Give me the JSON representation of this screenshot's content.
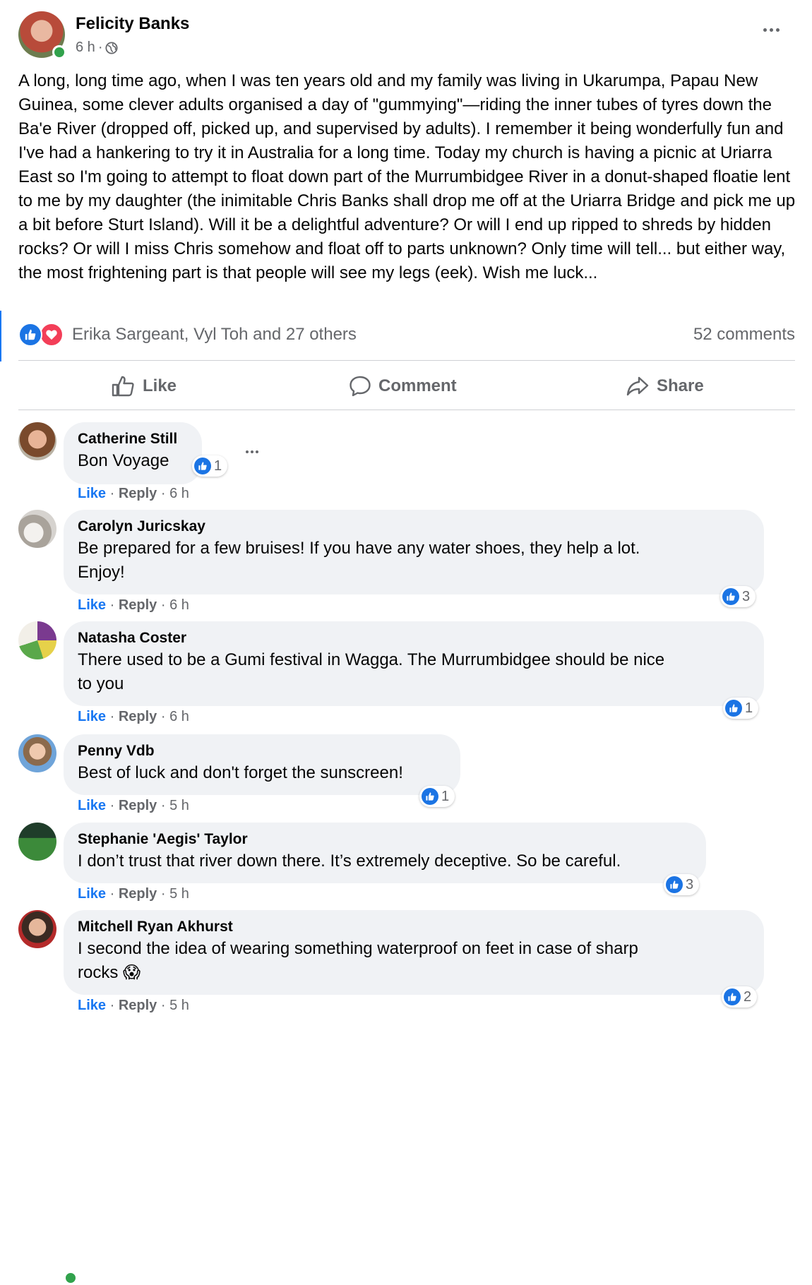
{
  "post": {
    "author": "Felicity Banks",
    "time": "6 h",
    "sep": "·",
    "text": "A long, long time ago, when I was ten years old and my family was living in Ukarumpa, Papau New Guinea, some clever adults organised a day of \"gummying\"—riding the inner tubes of tyres down the Ba'e River (dropped off, picked up, and supervised by adults). I remember it being wonderfully fun and I've had a hankering to try it in Australia for a long time. Today my church is having a picnic at Uriarra East so I'm going to attempt to float down part of the Murrumbidgee River in a donut-shaped floatie lent to me by my daughter (the inimitable Chris Banks shall drop me off at the Uriarra Bridge and pick me up a bit before Sturt Island). Will it be a delightful adventure? Or will I end up ripped to shreds by hidden rocks? Or will I miss Chris somehow and float off to parts unknown? Only time will tell... but either way, the most frightening part is that people will see my legs (eek). Wish me luck...",
    "reactions": "Erika Sargeant, Vyl Toh and 27 others",
    "comments_count": "52 comments"
  },
  "actions": {
    "like": "Like",
    "comment": "Comment",
    "share": "Share"
  },
  "comment_labels": {
    "like": "Like",
    "reply": "Reply",
    "dot": "·"
  },
  "comments": [
    {
      "name": "Catherine Still",
      "line1": "Bon Voyage",
      "line2": "",
      "reactions": "1",
      "time": "6 h"
    },
    {
      "name": "Carolyn Juricskay",
      "line1": "Be prepared for a few bruises! If you have any water shoes, they help a lot.",
      "line2": "Enjoy!",
      "reactions": "3",
      "time": "6 h"
    },
    {
      "name": "Natasha Coster",
      "line1": "There used to be a Gumi festival in Wagga. The Murrumbidgee should be nice",
      "line2": "to you",
      "reactions": "1",
      "time": "6 h"
    },
    {
      "name": "Penny Vdb",
      "line1": "Best of luck and don't forget the sunscreen!",
      "line2": "",
      "reactions": "1",
      "time": "5 h"
    },
    {
      "name": "Stephanie 'Aegis' Taylor",
      "line1": "I don’t trust that river down there. It’s extremely deceptive. So be careful.",
      "line2": "",
      "reactions": "3",
      "time": "5 h"
    },
    {
      "name": "Mitchell Ryan Akhurst",
      "line1": "I second the idea of wearing something waterproof on feet in case of sharp",
      "line2": "rocks 😱",
      "reactions": "2",
      "time": "5 h"
    }
  ],
  "colors": {
    "accent": "#1877f2",
    "like_blue": "#1b74e4",
    "love_red": "#f33e58",
    "bubble": "#f0f2f5",
    "online": "#31a24c"
  }
}
